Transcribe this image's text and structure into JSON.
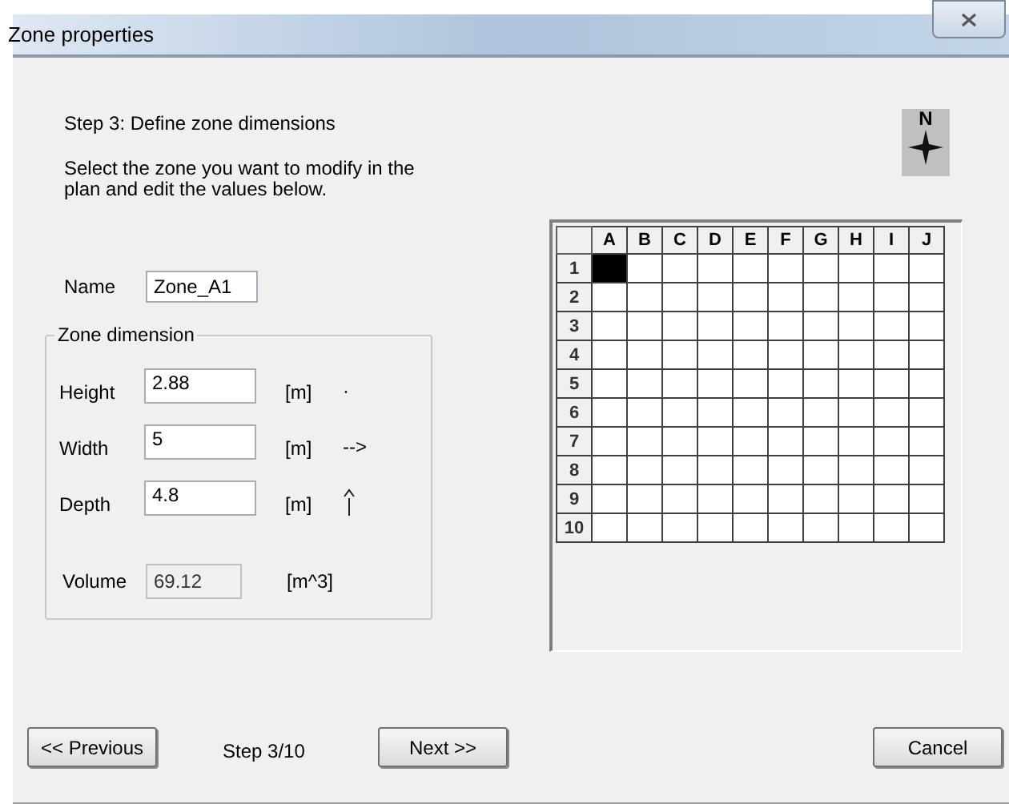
{
  "window": {
    "title": "Zone properties"
  },
  "step_title": "Step 3: Define zone dimensions",
  "instructions": "Select the zone you want to modify in the plan and edit the values below.",
  "compass": {
    "label": "N"
  },
  "name_field": {
    "label": "Name",
    "value": "Zone_A1"
  },
  "dimension_group": {
    "title": "Zone dimension",
    "rows": [
      {
        "label": "Height",
        "value": "2.88",
        "unit": "[m]",
        "hint": {
          "kind": "text",
          "text": "·"
        }
      },
      {
        "label": "Width",
        "value": "5",
        "unit": "[m]",
        "hint": {
          "kind": "text",
          "text": "-->"
        }
      },
      {
        "label": "Depth",
        "value": "4.8",
        "unit": "[m]",
        "hint": {
          "kind": "arrow-up"
        }
      }
    ],
    "volume": {
      "label": "Volume",
      "value": "69.12",
      "unit": "[m^3]",
      "disabled": true
    }
  },
  "grid": {
    "columns": [
      "A",
      "B",
      "C",
      "D",
      "E",
      "F",
      "G",
      "H",
      "I",
      "J"
    ],
    "rows": [
      {
        "label": "1",
        "cells": [
          true,
          false,
          false,
          false,
          false,
          false,
          false,
          false,
          false,
          false
        ]
      },
      {
        "label": "2",
        "cells": [
          false,
          false,
          false,
          false,
          false,
          false,
          false,
          false,
          false,
          false
        ]
      },
      {
        "label": "3",
        "cells": [
          false,
          false,
          false,
          false,
          false,
          false,
          false,
          false,
          false,
          false
        ]
      },
      {
        "label": "4",
        "cells": [
          false,
          false,
          false,
          false,
          false,
          false,
          false,
          false,
          false,
          false
        ]
      },
      {
        "label": "5",
        "cells": [
          false,
          false,
          false,
          false,
          false,
          false,
          false,
          false,
          false,
          false
        ]
      },
      {
        "label": "6",
        "cells": [
          false,
          false,
          false,
          false,
          false,
          false,
          false,
          false,
          false,
          false
        ]
      },
      {
        "label": "7",
        "cells": [
          false,
          false,
          false,
          false,
          false,
          false,
          false,
          false,
          false,
          false
        ]
      },
      {
        "label": "8",
        "cells": [
          false,
          false,
          false,
          false,
          false,
          false,
          false,
          false,
          false,
          false
        ]
      },
      {
        "label": "9",
        "cells": [
          false,
          false,
          false,
          false,
          false,
          false,
          false,
          false,
          false,
          false
        ]
      },
      {
        "label": "10",
        "cells": [
          false,
          false,
          false,
          false,
          false,
          false,
          false,
          false,
          false,
          false
        ]
      }
    ]
  },
  "footer": {
    "previous": "<< Previous",
    "step": "Step 3/10",
    "next": "Next >>",
    "cancel": "Cancel"
  }
}
